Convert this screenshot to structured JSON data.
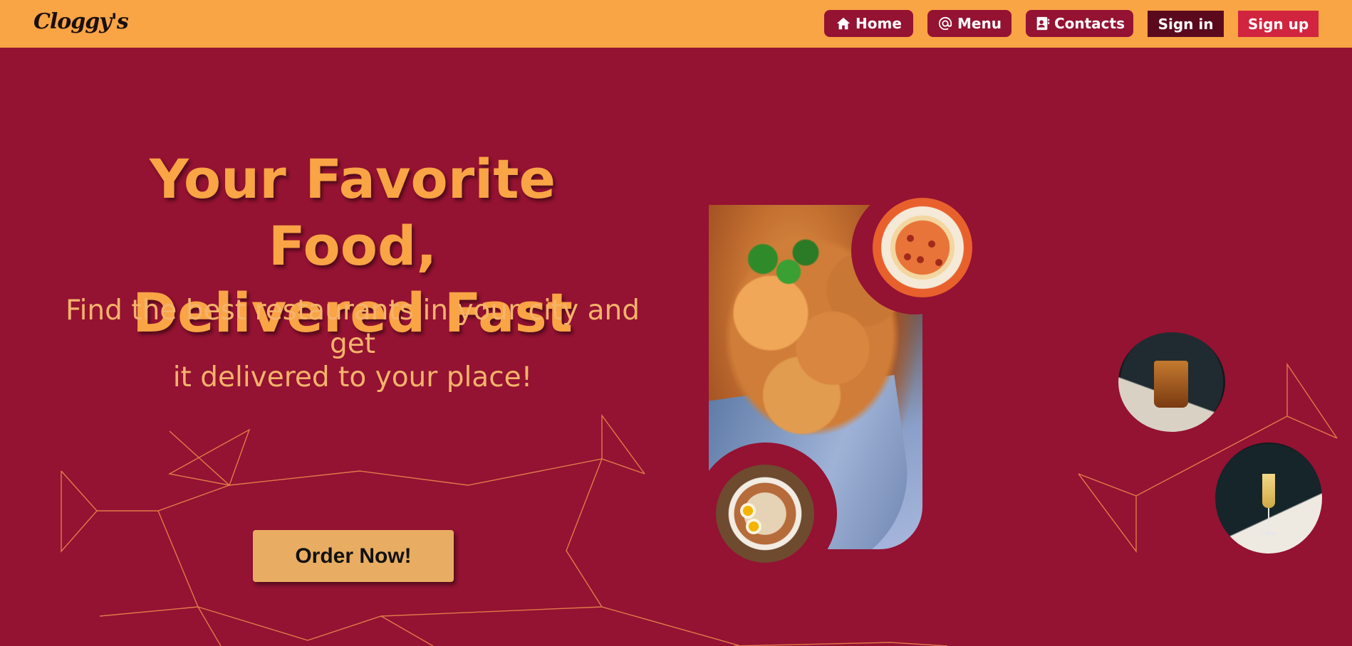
{
  "navbar": {
    "logo": "Cloggy's",
    "home_label": "Home",
    "menu_label": "Menu",
    "contacts_label": "Contacts",
    "signin_label": "Sign in",
    "signup_label": "Sign up",
    "icons": [
      "home-icon",
      "at-icon",
      "contact-card-icon"
    ]
  },
  "hero": {
    "title_line1": "Your Favorite Food,",
    "title_line2": "Delivered Fast",
    "subtitle_line1": "Find the best restaurants in your city and get",
    "subtitle_line2": "it delivered to your place!",
    "order_button": "Order Now!"
  },
  "colors": {
    "background": "#941232",
    "navbar": "#f9a445",
    "accent": "#f9a445",
    "signin": "#5b0a1e",
    "signup": "#d1243f",
    "order_button": "#e8ad62"
  },
  "images": [
    "fried-chicken-bowl",
    "pizza",
    "ramen-bowl",
    "whisky-glass",
    "champagne-flute"
  ]
}
